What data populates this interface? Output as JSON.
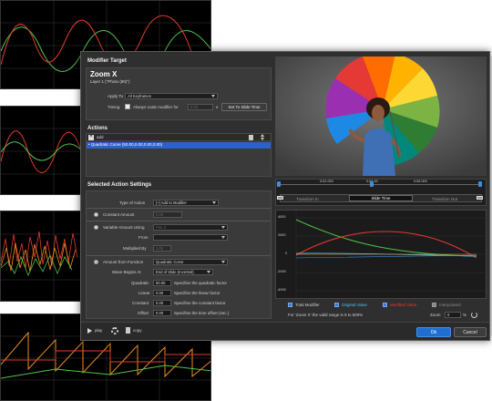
{
  "background_graphs": {
    "colors": {
      "red": "#e23b2e",
      "green": "#4fc34a",
      "orange": "#f08a1e"
    }
  },
  "dialog": {
    "modifier_target": {
      "title": "Modifier Target",
      "target_name": "Zoom X",
      "layer": "Layer 1 (\"Photo (80)\")",
      "apply_to_label": "Apply To",
      "apply_to_value": "All Keyframes",
      "timing_label": "Timing",
      "always_scale_label": "Always scale modifier for",
      "scale_value": "0.00",
      "scale_unit": "s",
      "set_slide_time_label": "Set To Slide Time"
    },
    "actions": {
      "title": "Actions",
      "add_label": "add",
      "items": [
        "• Quadratic Curve (50.00,0.00,0.00,0.00)"
      ]
    },
    "settings": {
      "title": "Selected Action Settings",
      "type_label": "Type of Action",
      "type_value": "[+] Add to Modifier",
      "constant_amount_label": "Constant Amount",
      "constant_amount_value": "0.00",
      "variable_label": "Variable Amount Using",
      "variable_value": "Pan X",
      "from_label": "From",
      "from_value": "",
      "multiplied_label": "Multiplied By",
      "multiplied_value": "1.00",
      "amount_function_label": "Amount from Function",
      "function_value": "Quadratic Curve",
      "wave_label": "Wave Begins At",
      "wave_value": "End of Slide (Inverted)",
      "quadratic_label": "Quadratic",
      "quadratic_value": "50.00",
      "quadratic_desc": "Specifies the quadratic factor",
      "linear_label": "Linear",
      "linear_value": "0.00",
      "linear_desc": "Specifies the linear factor",
      "constant_label": "Constant",
      "constant_value": "0.00",
      "constant_desc": "Specifies the constant factor",
      "offset_label": "Offset",
      "offset_value": "0.00",
      "offset_desc": "Specifies the time offset (sec.)"
    },
    "timeline": {
      "ticks": [
        "0:02.000",
        "0:04.00",
        "0:06.000"
      ],
      "transition_in": "Transition In",
      "slide_time": "Slide Time",
      "transition_out": "Transition Out",
      "out_left": "out",
      "out_right": "out"
    },
    "graph": {
      "y_labels": [
        "4000",
        "2000",
        "0",
        "-2000",
        "-4000"
      ]
    },
    "legend": {
      "total": "Total Modifier",
      "original": "Original Value",
      "modified": "Modified Value",
      "interpolated": "Interpolated"
    },
    "info": {
      "range_text": "For 'Zoom X' the valid range is 0 to 500%",
      "zoom_label": "Zoom",
      "zoom_value": "0",
      "zoom_unit": "%"
    },
    "bottom": {
      "play_label": "play",
      "copy_label": "copy",
      "ok_label": "Ok",
      "cancel_label": "Cancel"
    },
    "colors": {
      "accent": "#1f6fd1",
      "selection": "#2a62c9",
      "total": "#3b8ee0",
      "original": "#4fc3f7",
      "modified": "#e53935",
      "interpolated": "#888888"
    }
  }
}
